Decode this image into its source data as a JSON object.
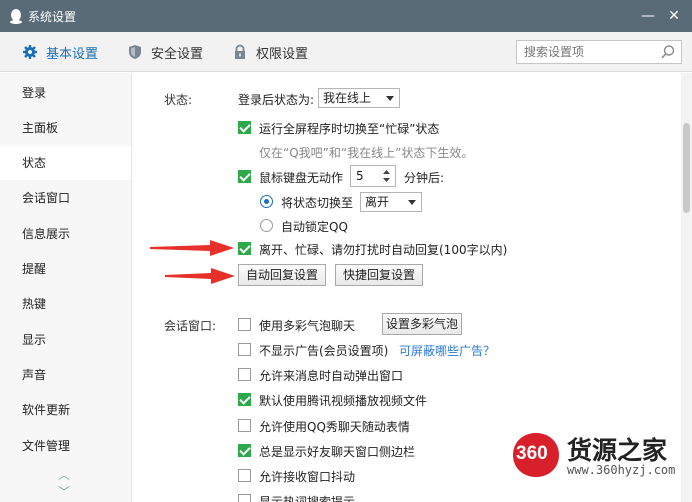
{
  "window": {
    "title": "系统设置",
    "minimize_glyph": "—",
    "close_glyph": "✕"
  },
  "nav": {
    "tabs": [
      {
        "label": "基本设置",
        "icon": "gear-icon",
        "active": true
      },
      {
        "label": "安全设置",
        "icon": "shield-icon",
        "active": false
      },
      {
        "label": "权限设置",
        "icon": "lock-icon",
        "active": false
      }
    ],
    "search_placeholder": "搜索设置项"
  },
  "sidebar": {
    "items": [
      {
        "label": "登录",
        "active": false
      },
      {
        "label": "主面板",
        "active": false
      },
      {
        "label": "状态",
        "active": true
      },
      {
        "label": "会话窗口",
        "active": false
      },
      {
        "label": "信息展示",
        "active": false
      },
      {
        "label": "提醒",
        "active": false
      },
      {
        "label": "热键",
        "active": false
      },
      {
        "label": "显示",
        "active": false
      },
      {
        "label": "声音",
        "active": false
      },
      {
        "label": "软件更新",
        "active": false
      },
      {
        "label": "文件管理",
        "active": false
      }
    ],
    "scroll_up": "︿",
    "scroll_down": "﹀"
  },
  "status": {
    "section_label": "状态:",
    "login_status_label": "登录后状态为:",
    "login_status_value": "我在线上",
    "fullscreen_busy": {
      "label": "运行全屏程序时切换至“忙碌”状态",
      "checked": true
    },
    "fullscreen_note": "仅在“Q我吧”和“我在线上”状态下生效。",
    "idle": {
      "label_before": "鼠标键盘无动作",
      "minutes": "5",
      "label_after": "分钟后:",
      "checked": true
    },
    "switch_to": {
      "label": "将状态切换至",
      "value": "离开",
      "selected": true
    },
    "auto_lock": {
      "label": "自动锁定QQ",
      "selected": false
    },
    "auto_reply": {
      "label": "离开、忙碌、请勿打扰时自动回复(100字以内)",
      "checked": true
    },
    "auto_reply_button": "自动回复设置",
    "quick_reply_button": "快捷回复设置"
  },
  "chat_window": {
    "section_label": "会话窗口:",
    "multicolor_bubble": {
      "label": "使用多彩气泡聊天",
      "checked": false
    },
    "multicolor_button": "设置多彩气泡",
    "hide_ads": {
      "label": "不显示广告(会员设置项)",
      "checked": false
    },
    "hide_ads_link": "可屏蔽哪些广告？",
    "popup_on_message": {
      "label": "允许来消息时自动弹出窗口",
      "checked": false
    },
    "tencent_video": {
      "label": "默认使用腾讯视频播放视频文件",
      "checked": true
    },
    "qq_show": {
      "label": "允许使用QQ秀聊天随动表情",
      "checked": false
    },
    "sidebar_always": {
      "label": "总是显示好友聊天窗口侧边栏",
      "checked": true
    },
    "window_shake": {
      "label": "允许接收窗口抖动",
      "checked": false
    },
    "hot_words": {
      "label": "显示热词搜索提示",
      "checked": false
    }
  },
  "watermark": {
    "number": "360",
    "brand": "货源之家",
    "url": "www.360hyzj.com"
  },
  "colors": {
    "titlebar": "#5a6b78",
    "accent": "#1a6fb8",
    "check_green": "#2ea84b",
    "arrow_red": "#e8302a"
  }
}
